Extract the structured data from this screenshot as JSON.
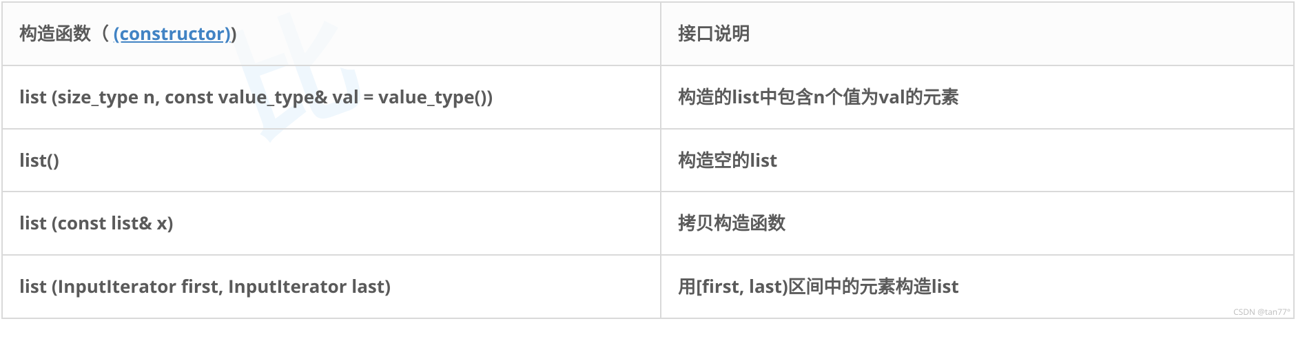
{
  "watermark": "比",
  "table": {
    "header": {
      "left_prefix": "构造函数（ ",
      "left_link": "(constructor)",
      "left_suffix": ")",
      "right": "接口说明"
    },
    "rows": [
      {
        "left": "list (size_type n, const value_type& val = value_type())",
        "right": "构造的list中包含n个值为val的元素"
      },
      {
        "left": "list()",
        "right": "构造空的list"
      },
      {
        "left": "list (const list& x)",
        "right": "拷贝构造函数"
      },
      {
        "left": "list (InputIterator first, InputIterator last)",
        "right": "用[first, last)区间中的元素构造list"
      }
    ]
  },
  "credit": "CSDN @tan77°"
}
